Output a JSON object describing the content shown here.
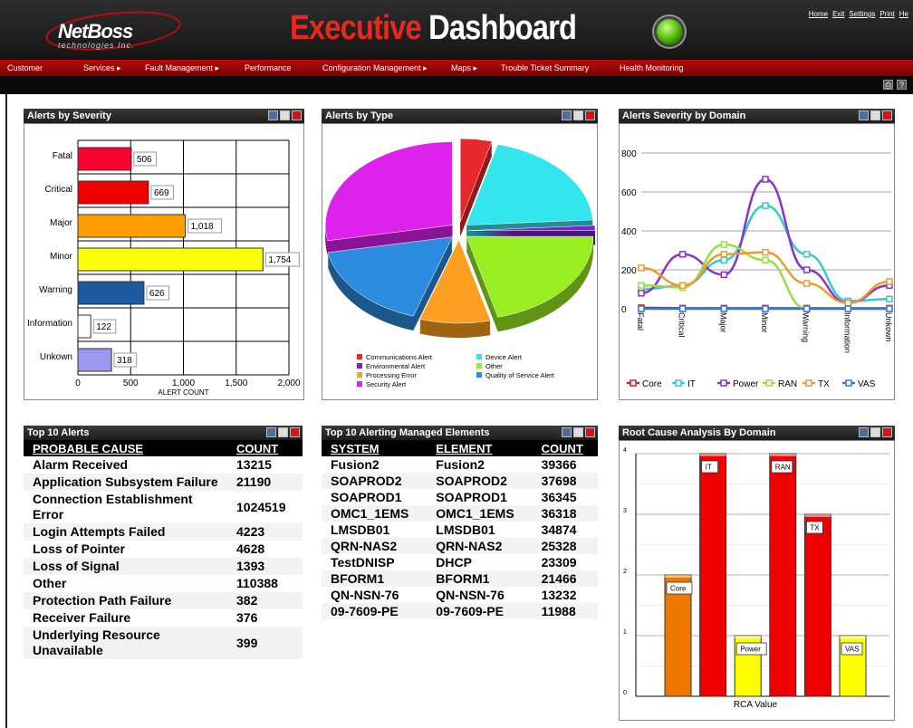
{
  "app": {
    "logo_text": "NetBoss",
    "logo_sub": "technologies Inc.",
    "title_part1": "Executive",
    "title_part2": "Dashboard",
    "top_links": [
      "Home",
      "Exit",
      "Settings",
      "Print",
      "He"
    ]
  },
  "menu": [
    "Customer",
    "Services",
    "Fault Management",
    "Performance",
    "Configuration Management",
    "Maps",
    "Trouble Ticket Summary",
    "Health Monitoring"
  ],
  "panels": {
    "severity": {
      "title": "Alerts by Severity",
      "chart_data": {
        "type": "bar",
        "orientation": "horizontal",
        "categories": [
          "Fatal",
          "Critical",
          "Major",
          "Minor",
          "Warning",
          "Information",
          "Unkown"
        ],
        "values": [
          506,
          669,
          1018,
          1754,
          626,
          122,
          318
        ],
        "value_labels": [
          "506",
          "669",
          "1,018",
          "1,754",
          "626",
          "122",
          "318"
        ],
        "colors": [
          "#ff0033",
          "#f00000",
          "#ffa000",
          "#ffff00",
          "#1e5aa0",
          "#ffffff",
          "#9999ee"
        ],
        "xlabel": "ALERT COUNT",
        "xlim": [
          0,
          2000
        ],
        "ticks": [
          "0",
          "500",
          "1,000",
          "1,500",
          "2,000"
        ],
        "grid": true
      }
    },
    "type": {
      "title": "Alerts by Type",
      "chart_data": {
        "type": "pie",
        "slices": [
          {
            "name": "Communications Alert",
            "value": 4,
            "color": "#e8282b"
          },
          {
            "name": "Device Alert",
            "value": 20,
            "color": "#33e6ee"
          },
          {
            "name": "Environmental Alert",
            "value": 1,
            "color": "#7a22cc"
          },
          {
            "name": "Other",
            "value": 21,
            "color": "#99ee22"
          },
          {
            "name": "Processing Error",
            "value": 9,
            "color": "#ff9f22"
          },
          {
            "name": "Quality of Service Alert",
            "value": 17,
            "color": "#2c8de0"
          },
          {
            "name": "Security Alert",
            "value": 28,
            "color": "#dd22ee"
          }
        ]
      }
    },
    "domain": {
      "title": "Alerts Severity by Domain",
      "chart_data": {
        "type": "line",
        "categories": [
          "Fatal",
          "Critical",
          "Major",
          "Minor",
          "Warning",
          "Information",
          "Unkown"
        ],
        "ylim": [
          0,
          800
        ],
        "yticks": [
          "0",
          "200",
          "400",
          "600",
          "800"
        ],
        "grid": true,
        "legend": "bottom",
        "series": [
          {
            "name": "Core",
            "color": "#cc2222",
            "values": [
              5,
              3,
              3,
              3,
              3,
              3,
              3
            ]
          },
          {
            "name": "IT",
            "color": "#33cccc",
            "values": [
              100,
              120,
              250,
              530,
              280,
              40,
              50
            ]
          },
          {
            "name": "Power",
            "color": "#8833cc",
            "values": [
              80,
              280,
              175,
              665,
              200,
              30,
              120
            ]
          },
          {
            "name": "RAN",
            "color": "#99dd44",
            "values": [
              120,
              110,
              330,
              250,
              0,
              0,
              0
            ]
          },
          {
            "name": "TX",
            "color": "#ee9933",
            "values": [
              210,
              120,
              280,
              290,
              130,
              30,
              140
            ]
          },
          {
            "name": "VAS",
            "color": "#3377dd",
            "values": [
              0,
              0,
              0,
              0,
              0,
              0,
              0
            ]
          }
        ]
      }
    },
    "top_alerts": {
      "title": "Top 10 Alerts",
      "headers": [
        "PROBABLE CAUSE",
        "COUNT"
      ],
      "rows": [
        [
          "Alarm Received",
          "13215"
        ],
        [
          "Application Subsystem Failure",
          "21190"
        ],
        [
          "Connection Establishment Error",
          "1024519"
        ],
        [
          "Login Attempts Failed",
          "4223"
        ],
        [
          "Loss of Pointer",
          "4628"
        ],
        [
          "Loss of Signal",
          "1393"
        ],
        [
          "Other",
          "110388"
        ],
        [
          "Protection Path Failure",
          "382"
        ],
        [
          "Receiver Failure",
          "376"
        ],
        [
          "Underlying Resource Unavailable",
          "399"
        ]
      ]
    },
    "top_elements": {
      "title": "Top 10 Alerting Managed Elements",
      "headers": [
        "SYSTEM",
        "ELEMENT",
        "COUNT"
      ],
      "rows": [
        [
          "Fusion2",
          "Fusion2",
          "39366"
        ],
        [
          "SOAPROD2",
          "SOAPROD2",
          "37698"
        ],
        [
          "SOAPROD1",
          "SOAPROD1",
          "36345"
        ],
        [
          "OMC1_1EMS",
          "OMC1_1EMS",
          "36318"
        ],
        [
          "LMSDB01",
          "LMSDB01",
          "34874"
        ],
        [
          "QRN-NAS2",
          "QRN-NAS2",
          "25328"
        ],
        [
          "TestDNISP",
          "DHCP",
          "23309"
        ],
        [
          "BFORM1",
          "BFORM1",
          "21466"
        ],
        [
          "QN-NSN-76",
          "QN-NSN-76",
          "13232"
        ],
        [
          "09-7609-PE",
          "09-7609-PE",
          "11988"
        ]
      ]
    },
    "rca": {
      "title": "Root Cause Analysis By Domain",
      "chart_data": {
        "type": "bar",
        "categories": [
          "Core",
          "IT",
          "Power",
          "RAN",
          "TX",
          "VAS"
        ],
        "values": [
          2,
          4,
          1,
          4,
          3,
          1
        ],
        "colors": [
          "#ee7700",
          "#f00000",
          "#ffff00",
          "#f00000",
          "#f00000",
          "#ffff00"
        ],
        "ylim": [
          0,
          4
        ],
        "yticks": [
          "0",
          "1",
          "2",
          "3",
          "4"
        ],
        "xlabel": "RCA Value",
        "grid": true
      }
    }
  }
}
